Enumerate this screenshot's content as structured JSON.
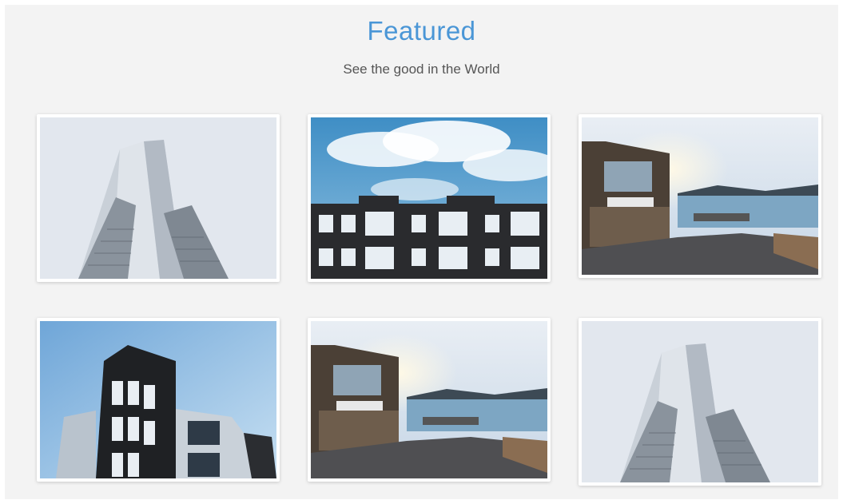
{
  "header": {
    "title": "Featured",
    "subtitle": "See the good in the World"
  },
  "colors": {
    "accent": "#4a96d6",
    "background": "#f3f3f3",
    "subtitle_text": "#555555"
  },
  "gallery": {
    "items": [
      {
        "subject": "glass-tower"
      },
      {
        "subject": "dark-apartment-block-with-clouds"
      },
      {
        "subject": "stone-house-by-the-sea"
      },
      {
        "subject": "dark-modern-building-blue-sky"
      },
      {
        "subject": "stone-house-by-the-sea"
      },
      {
        "subject": "glass-tower"
      }
    ]
  }
}
